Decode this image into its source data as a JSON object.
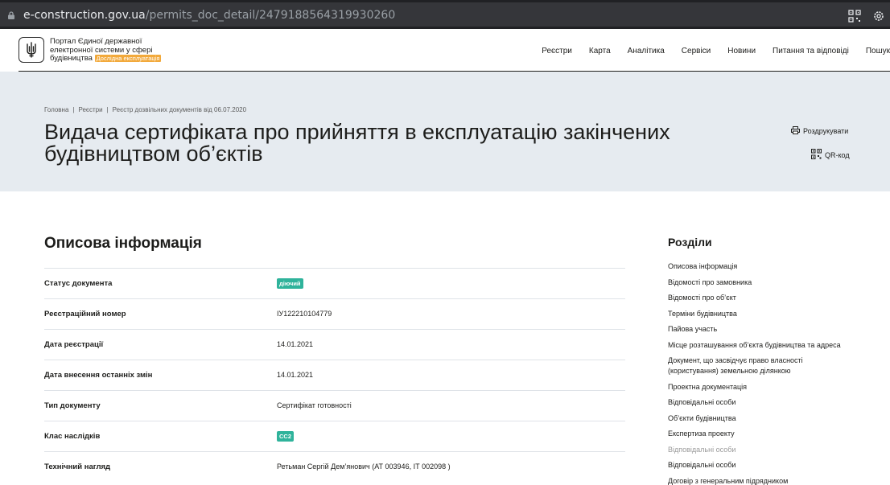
{
  "browser": {
    "url_host": "e-construction.gov.ua",
    "url_path": "/permits_doc_detail/2479188564319930260",
    "icons": [
      "lock-icon",
      "qr-icon",
      "settings-icon"
    ]
  },
  "header": {
    "portal_line1": "Портал Єдиної державної",
    "portal_line2": "електронної системи у сфері",
    "portal_line3": "будівництва",
    "badge": "Дослідна експлуатація",
    "nav": [
      "Реєстри",
      "Карта",
      "Аналітика",
      "Сервіси",
      "Новини",
      "Питання та відповіді",
      "Пошук"
    ]
  },
  "hero": {
    "breadcrumb": [
      "Головна",
      "Реєстри",
      "Реєстр дозвільних документів від 06.07.2020"
    ],
    "title_line1": "Видача сертифіката про прийняття в експлуатацію закінчених",
    "title_line2": "будівництвом об’єктів",
    "print_label": "Роздрукувати",
    "qr_label": "QR-код"
  },
  "main": {
    "section_title": "Описова інформація",
    "rows": [
      {
        "key": "Статус документа",
        "value": "діючий"
      },
      {
        "key": "Реєстраційний номер",
        "value": "ІУ122210104779"
      },
      {
        "key": "Дата реєстрації",
        "value": "14.01.2021"
      },
      {
        "key": "Дата внесення останніх змін",
        "value": "14.01.2021"
      },
      {
        "key": "Тип документу",
        "value": "Сертифікат готовності"
      },
      {
        "key": "Клас наслідків",
        "value": "СС2"
      },
      {
        "key": "Технічний нагляд",
        "value": "Ретьман Сергій Дем’янович (АТ 003946, ІТ 002098 )"
      }
    ]
  },
  "sidebar": {
    "title": "Розділи",
    "items": [
      "Описова інформація",
      "Відомості про замовника",
      "Відомості про об’єкт",
      "Терміни будівництва",
      "Пайова участь",
      "Місце розташування об’єкта будівництва та адреса",
      "Документ, що засвідчує право власності",
      "(користування) земельною ділянкою",
      "Проектна документація",
      "Відповідальні особи",
      "Об’єкти будівництва",
      "Експертиза проекту",
      "Відповідальні особи",
      "Відповідальні особи",
      "Договір з генеральним підрядником"
    ]
  },
  "colors": {
    "hero_bg": "#e6ebf0",
    "badge_orange": "#f2a93b",
    "status_green": "#2fb39b"
  }
}
